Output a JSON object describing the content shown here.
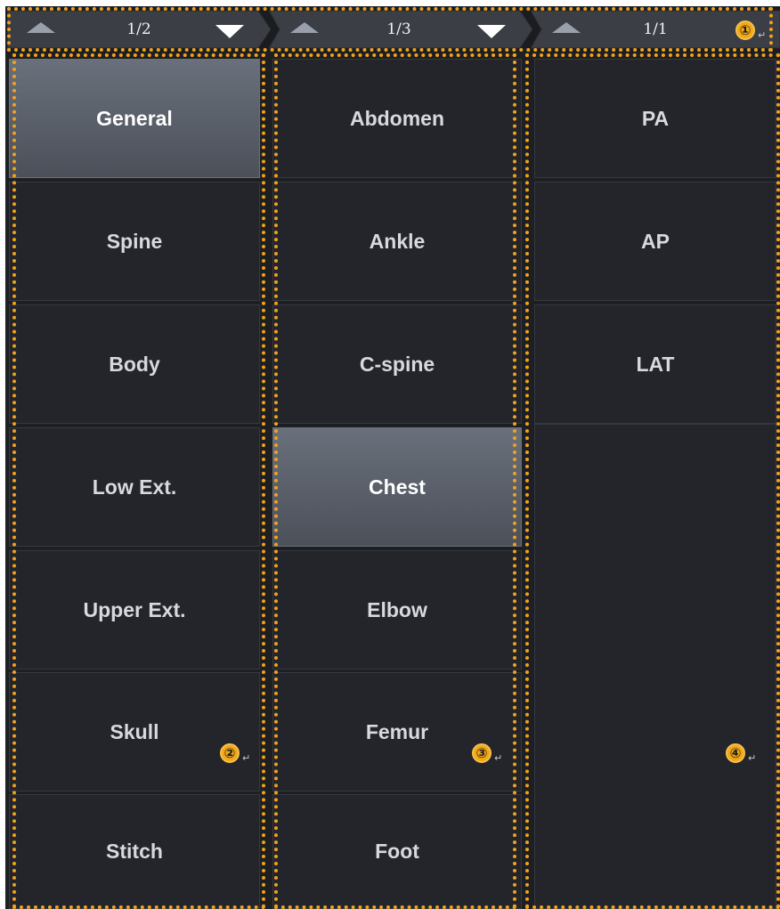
{
  "pagers": [
    {
      "page": "1/2"
    },
    {
      "page": "1/3"
    },
    {
      "page": "1/1"
    }
  ],
  "column1": {
    "items": [
      "General",
      "Spine",
      "Body",
      "Low Ext.",
      "Upper Ext.",
      "Skull",
      "Stitch"
    ],
    "selected": "General"
  },
  "column2": {
    "items": [
      "Abdomen",
      "Ankle",
      "C-spine",
      "Chest",
      "Elbow",
      "Femur",
      "Foot"
    ],
    "selected": "Chest"
  },
  "column3": {
    "items": [
      "PA",
      "AP",
      "LAT"
    ]
  },
  "callouts": [
    "①",
    "②",
    "③",
    "④"
  ],
  "return_mark": "↵",
  "colors": {
    "accent": "#f0a21c",
    "cell_bg": "#23252b",
    "selected_bg": "#5d626c",
    "text": "#d8d9dc"
  }
}
